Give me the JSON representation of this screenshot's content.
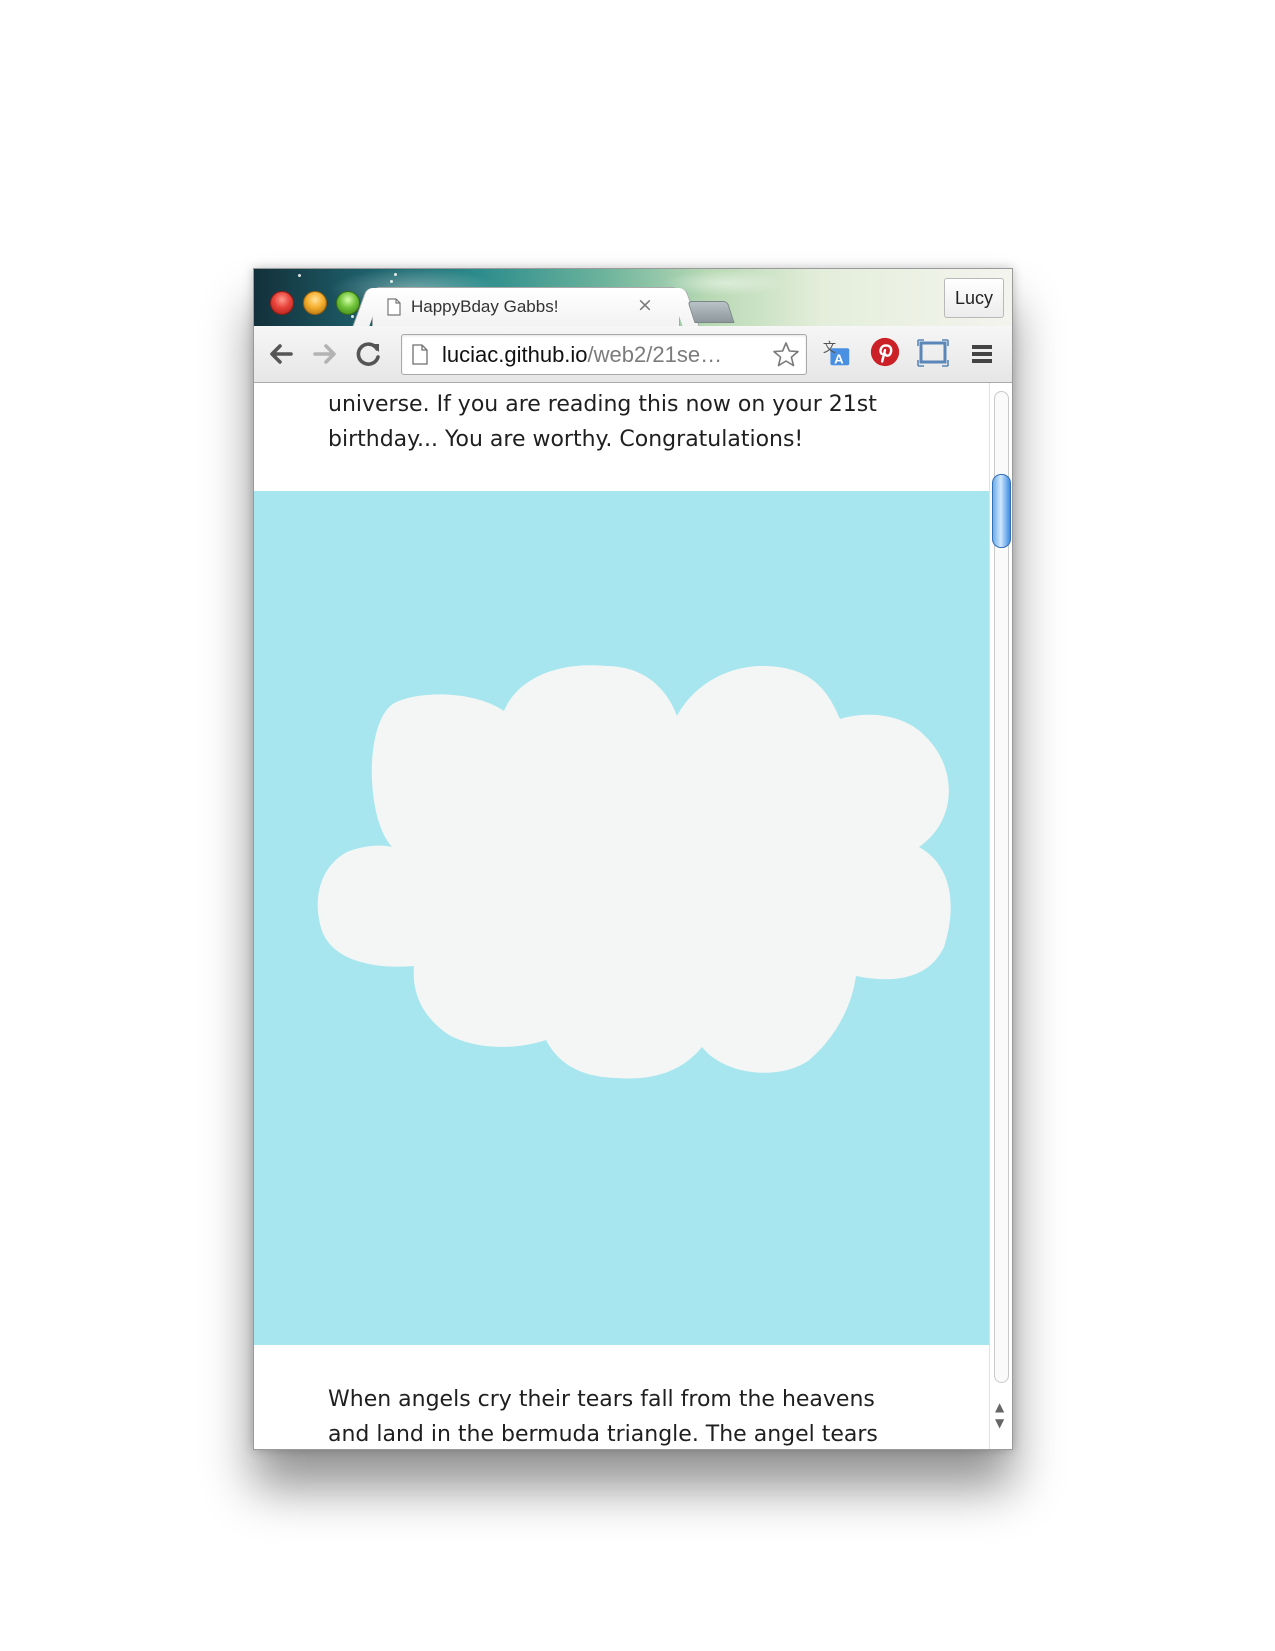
{
  "browser": {
    "tab": {
      "title": "HappyBday Gabbs!",
      "close_glyph": "×"
    },
    "profile_name": "Lucy",
    "toolbar": {
      "back_icon": "back-arrow-icon",
      "forward_icon": "forward-arrow-icon",
      "reload_icon": "reload-icon",
      "extensions": [
        "translate-icon",
        "pinterest-icon",
        "cast-screen-icon"
      ],
      "menu_icon": "hamburger-menu-icon"
    },
    "address_bar": {
      "host": "luciac.github.io",
      "path": "/web2/21se…"
    }
  },
  "page": {
    "paragraph_top_lines": [
      "universe. If you are reading this now on your 21st",
      "birthday... You are worthy. Congratulations!"
    ],
    "paragraph_bottom_lines": [
      "When angels cry their tears fall from the heavens",
      "and land in the bermuda triangle. The angel tears"
    ],
    "illustration": {
      "name": "cloud",
      "sky_color": "#a7e6ee",
      "cloud_color": "#f4f6f6"
    }
  },
  "scrollbar": {
    "up_arrow": "▲",
    "down_arrow": "▼"
  }
}
